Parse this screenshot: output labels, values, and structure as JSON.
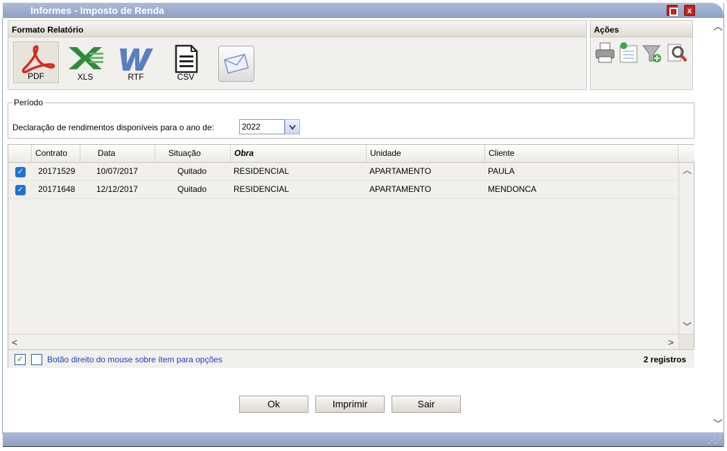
{
  "window": {
    "title": "Informes - Imposto de Renda",
    "close_label": "x"
  },
  "formato": {
    "title": "Formato Relatório",
    "items": [
      {
        "label": "PDF",
        "icon": "pdf-icon",
        "selected": true
      },
      {
        "label": "XLS",
        "icon": "xls-icon"
      },
      {
        "label": "RTF",
        "icon": "rtf-icon"
      },
      {
        "label": "CSV",
        "icon": "csv-icon"
      }
    ],
    "email_icon": "envelope-icon"
  },
  "acoes": {
    "title": "Ações",
    "icons": [
      "printer-icon",
      "document-add-icon",
      "filter-add-icon",
      "search-document-icon"
    ]
  },
  "periodo": {
    "legend": "Período",
    "label": "Declaração de rendimentos disponíveis para o ano de:",
    "year": "2022"
  },
  "grid": {
    "columns": [
      "Contrato",
      "Data",
      "Situação",
      "Obra",
      "Unidade",
      "Cliente"
    ],
    "rows": [
      {
        "checked": true,
        "contrato": "20171529",
        "data": "10/07/2017",
        "situacao": "Quitado",
        "obra": "RESIDENCIAL",
        "unidade": "APARTAMENTO",
        "cliente": "PAULA"
      },
      {
        "checked": true,
        "contrato": "20171648",
        "data": "12/12/2017",
        "situacao": "Quitado",
        "obra": "RESIDENCIAL",
        "unidade": "APARTAMENTO",
        "cliente": "MENDONCA"
      }
    ],
    "footer_hint": "Botão direito do mouse sobre ítem para opções",
    "record_count": "2 registros"
  },
  "buttons": {
    "ok": "Ok",
    "imprimir": "Imprimir",
    "sair": "Sair"
  },
  "colors": {
    "title_bar": "#8f9fc6",
    "checkbox": "#1f72d0",
    "pdf_red": "#d42a1f",
    "xls_green": "#2e8b3a",
    "rtf_blue": "#5a7fbf",
    "hint_text": "#1a3fbf"
  }
}
